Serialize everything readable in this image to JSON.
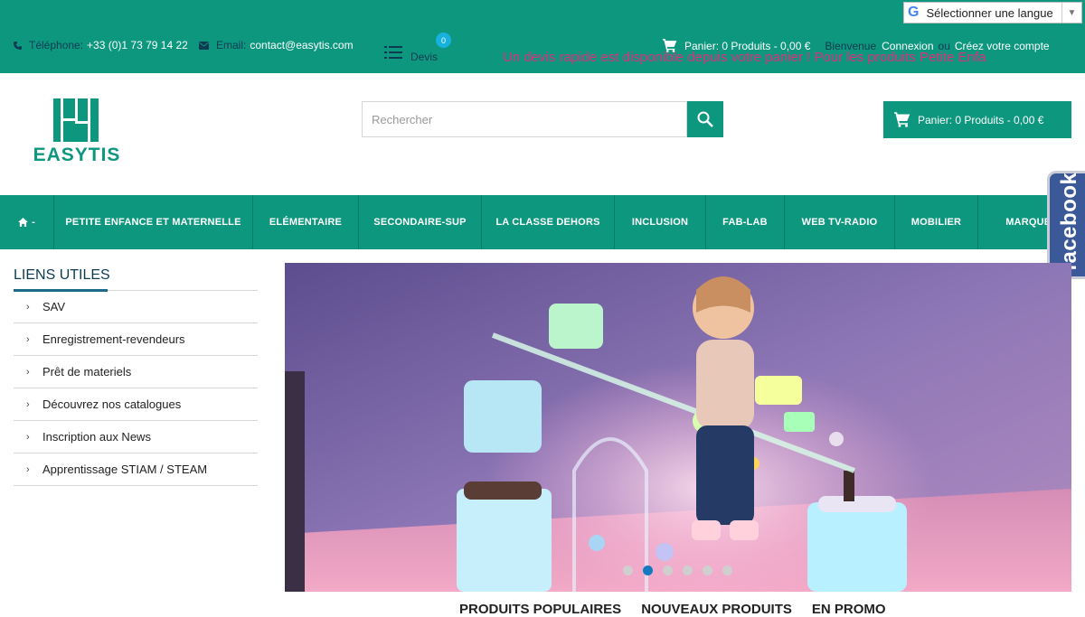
{
  "topbar": {
    "phone_label": "Téléphone:",
    "phone_value": "+33 (0)1 73 79 14 22",
    "email_label": "Email:",
    "email_value": "contact@easytis.com",
    "devis_label": "Devis",
    "devis_count": "0",
    "cart_label": "Panier: 0 Produits - 0,00 €",
    "welcome_label": "Bienvenue",
    "login_link": "Connexion",
    "or_label": "ou",
    "register_link": "Créez votre compte",
    "marquee_text": "Un devis rapide est disponible depuis votre panier ! Pour les produits Petite Enfa",
    "marquee_color": "#e0307c"
  },
  "language": {
    "label": "Sélectionner une langue"
  },
  "header": {
    "logo_text": "EASYTIS",
    "search_placeholder": "Rechercher",
    "cart_button": "Panier: 0 Produits - 0,00 €"
  },
  "nav": {
    "items": [
      {
        "label": "-",
        "icon": "home-icon"
      },
      {
        "label": "PETITE ENFANCE ET MATERNELLE"
      },
      {
        "label": "ELÉMENTAIRE"
      },
      {
        "label": "SECONDAIRE-SUP"
      },
      {
        "label": "LA CLASSE DEHORS"
      },
      {
        "label": "INCLUSION"
      },
      {
        "label": "FAB-LAB"
      },
      {
        "label": "WEB TV-RADIO"
      },
      {
        "label": "MOBILIER"
      },
      {
        "label": "MARQUES"
      }
    ]
  },
  "facebook": {
    "label": "facebook"
  },
  "sidebar": {
    "title": "LIENS UTILES",
    "items": [
      "SAV",
      "Enregistrement-revendeurs",
      "Prêt de materiels",
      "Découvrez nos catalogues",
      "Inscription aux News",
      "Apprentissage STIAM / STEAM"
    ]
  },
  "slider": {
    "slide_count": 6,
    "active_slide": 2
  },
  "product_tabs": [
    "PRODUITS POPULAIRES",
    "NOUVEAUX PRODUITS",
    "EN PROMO"
  ],
  "colors": {
    "brand": "#0c977e",
    "dark_text": "#0d3b52",
    "accent_blue": "#1579c2",
    "facebook": "#3b5998"
  }
}
